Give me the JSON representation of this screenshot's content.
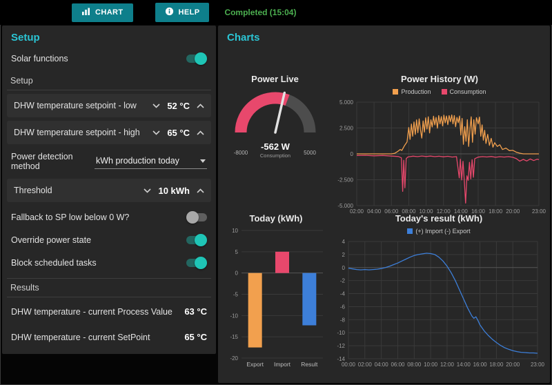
{
  "topbar": {
    "chart_label": "CHART",
    "help_label": "HELP",
    "status": "Completed (15:04)"
  },
  "setup_panel": {
    "title": "Setup",
    "solar": {
      "label": "Solar functions",
      "state": "on"
    },
    "section_setup": "Setup",
    "sp_low": {
      "label": "DHW temperature setpoint - low",
      "value": "52 °C"
    },
    "sp_high": {
      "label": "DHW temperature setpoint - high",
      "value": "65 °C"
    },
    "detection": {
      "label": "Power detection method",
      "value": "kWh production today"
    },
    "threshold": {
      "label": "Threshold",
      "value": "10 kWh"
    },
    "fallback": {
      "label": "Fallback to SP low below 0 W?",
      "state": "off"
    },
    "override": {
      "label": "Override power state",
      "state": "on"
    },
    "block": {
      "label": "Block scheduled tasks",
      "state": "on"
    },
    "section_results": "Results",
    "pv": {
      "label": "DHW temperature - current Process Value",
      "value": "63 °C"
    },
    "sp": {
      "label": "DHW temperature - current SetPoint",
      "value": "65 °C"
    }
  },
  "charts_panel": {
    "title": "Charts"
  },
  "colors": {
    "accent_teal": "#0e7f8b",
    "title_teal": "#2bc5d4",
    "status_green": "#4caf50",
    "production_orange": "#f2a04e",
    "consumption_red": "#e8486c",
    "result_blue": "#3d7fd9",
    "gauge_gray": "#4d4d4d",
    "toggle_on": "#1fc5b6"
  },
  "chart_data": [
    {
      "type": "gauge",
      "title": "Power Live",
      "value": -562,
      "value_label": "-562 W",
      "unit_label": "Consumption",
      "min": -8000,
      "max": 5000,
      "min_label": "-8000",
      "max_label": "5000",
      "zones": [
        {
          "from": -8000,
          "to": 0,
          "color": "#e8486c"
        },
        {
          "from": 0,
          "to": 5000,
          "color": "#4d4d4d"
        }
      ]
    },
    {
      "type": "line",
      "title": "Power History (W)",
      "xlim": [
        2,
        23
      ],
      "ylim": [
        -5000,
        5000
      ],
      "y_ticks": [
        {
          "v": 5000,
          "label": "5.000"
        },
        {
          "v": 2500,
          "label": "2.500"
        },
        {
          "v": 0,
          "label": "0"
        },
        {
          "v": -2500,
          "label": "-2.500"
        },
        {
          "v": -5000,
          "label": "-5.000"
        }
      ],
      "x_ticks": [
        {
          "v": 2,
          "label": "02:00"
        },
        {
          "v": 4,
          "label": "04:00"
        },
        {
          "v": 6,
          "label": "06:00"
        },
        {
          "v": 8,
          "label": "08:00"
        },
        {
          "v": 10,
          "label": "10:00"
        },
        {
          "v": 12,
          "label": "12:00"
        },
        {
          "v": 14,
          "label": "14:00"
        },
        {
          "v": 16,
          "label": "16:00"
        },
        {
          "v": 18,
          "label": "18:00"
        },
        {
          "v": 20,
          "label": "20:00"
        },
        {
          "v": 23,
          "label": "23:00"
        }
      ],
      "series": [
        {
          "name": "Production",
          "color": "#f2a04e",
          "points": [
            [
              2,
              0
            ],
            [
              3,
              0
            ],
            [
              4,
              0
            ],
            [
              5,
              0
            ],
            [
              6,
              0
            ],
            [
              6.4,
              60
            ],
            [
              6.7,
              220
            ],
            [
              7,
              420
            ],
            [
              7.2,
              330
            ],
            [
              7.5,
              780
            ],
            [
              7.8,
              1150
            ],
            [
              8,
              2550
            ],
            [
              8.15,
              1400
            ],
            [
              8.3,
              2880
            ],
            [
              8.45,
              1700
            ],
            [
              8.6,
              3080
            ],
            [
              8.75,
              1880
            ],
            [
              8.9,
              3280
            ],
            [
              9.05,
              2050
            ],
            [
              9.2,
              3380
            ],
            [
              9.35,
              2300
            ],
            [
              9.5,
              1520
            ],
            [
              9.65,
              3180
            ],
            [
              9.8,
              2100
            ],
            [
              9.95,
              3480
            ],
            [
              10.1,
              2400
            ],
            [
              10.25,
              3580
            ],
            [
              10.4,
              2020
            ],
            [
              10.55,
              3300
            ],
            [
              10.7,
              2600
            ],
            [
              10.85,
              3640
            ],
            [
              11,
              2800
            ],
            [
              11.15,
              3520
            ],
            [
              11.3,
              2480
            ],
            [
              11.45,
              3700
            ],
            [
              11.6,
              2900
            ],
            [
              11.75,
              3600
            ],
            [
              11.9,
              2700
            ],
            [
              12.05,
              3740
            ],
            [
              12.2,
              3000
            ],
            [
              12.35,
              3660
            ],
            [
              12.5,
              2820
            ],
            [
              12.65,
              3700
            ],
            [
              12.8,
              3120
            ],
            [
              12.95,
              3760
            ],
            [
              13.1,
              2900
            ],
            [
              13.25,
              3700
            ],
            [
              13.4,
              2620
            ],
            [
              13.55,
              3520
            ],
            [
              13.7,
              3010
            ],
            [
              13.85,
              3660
            ],
            [
              14,
              1820
            ],
            [
              14.15,
              3420
            ],
            [
              14.3,
              920
            ],
            [
              14.45,
              2620
            ],
            [
              14.6,
              1220
            ],
            [
              14.75,
              3300
            ],
            [
              14.9,
              720
            ],
            [
              15.05,
              2400
            ],
            [
              15.2,
              3580
            ],
            [
              15.35,
              1120
            ],
            [
              15.5,
              3300
            ],
            [
              15.65,
              1900
            ],
            [
              15.8,
              3500
            ],
            [
              16,
              2900
            ],
            [
              16.15,
              3560
            ],
            [
              16.3,
              1700
            ],
            [
              16.45,
              2800
            ],
            [
              16.6,
              1320
            ],
            [
              16.75,
              2280
            ],
            [
              16.9,
              1010
            ],
            [
              17.1,
              1880
            ],
            [
              17.3,
              820
            ],
            [
              17.5,
              1500
            ],
            [
              17.7,
              640
            ],
            [
              17.9,
              1080
            ],
            [
              18.2,
              720
            ],
            [
              18.5,
              880
            ],
            [
              18.8,
              420
            ],
            [
              19.2,
              560
            ],
            [
              19.6,
              310
            ],
            [
              20,
              340
            ],
            [
              20.4,
              160
            ],
            [
              20.8,
              70
            ],
            [
              21.2,
              0
            ],
            [
              22,
              0
            ],
            [
              23,
              0
            ]
          ]
        },
        {
          "name": "Consumption",
          "color": "#e8486c",
          "points": [
            [
              2,
              -160
            ],
            [
              3,
              -140
            ],
            [
              4,
              -185
            ],
            [
              5,
              -150
            ],
            [
              6,
              -210
            ],
            [
              6.8,
              -250
            ],
            [
              7.15,
              -380
            ],
            [
              7.3,
              -3620
            ],
            [
              7.42,
              -620
            ],
            [
              7.55,
              -3280
            ],
            [
              7.7,
              -460
            ],
            [
              7.9,
              -300
            ],
            [
              8.5,
              -220
            ],
            [
              9,
              -265
            ],
            [
              9.5,
              -205
            ],
            [
              10,
              -255
            ],
            [
              10.5,
              -215
            ],
            [
              11,
              -265
            ],
            [
              11.5,
              -225
            ],
            [
              12,
              -285
            ],
            [
              12.5,
              -235
            ],
            [
              13,
              -305
            ],
            [
              13.5,
              -265
            ],
            [
              13.82,
              -2320
            ],
            [
              13.95,
              -520
            ],
            [
              14.1,
              -2520
            ],
            [
              14.25,
              -720
            ],
            [
              14.4,
              -2620
            ],
            [
              14.55,
              -4760
            ],
            [
              14.7,
              -2120
            ],
            [
              14.85,
              -2560
            ],
            [
              15,
              -820
            ],
            [
              15.15,
              -2420
            ],
            [
              15.3,
              -560
            ],
            [
              15.45,
              -2260
            ],
            [
              15.6,
              -470
            ],
            [
              16,
              -310
            ],
            [
              16.5,
              -265
            ],
            [
              17,
              -300
            ],
            [
              17.5,
              -255
            ],
            [
              18,
              -325
            ],
            [
              18.5,
              -275
            ],
            [
              19,
              -305
            ],
            [
              19.5,
              -265
            ],
            [
              20,
              -330
            ],
            [
              20.4,
              -460
            ],
            [
              20.8,
              -710
            ],
            [
              21.2,
              -530
            ],
            [
              21.6,
              -690
            ],
            [
              22,
              -490
            ],
            [
              22.4,
              -650
            ],
            [
              22.8,
              -510
            ],
            [
              23,
              -560
            ]
          ]
        }
      ]
    },
    {
      "type": "bar",
      "title": "Today (kWh)",
      "categories": [
        "Export",
        "Import",
        "Result"
      ],
      "values": [
        -17.5,
        5.0,
        -12.3
      ],
      "colors": [
        "#f2a04e",
        "#e8486c",
        "#3d7fd9"
      ],
      "ylim": [
        -20,
        10
      ],
      "y_ticks": [
        {
          "v": 10,
          "label": "10"
        },
        {
          "v": 5,
          "label": "5"
        },
        {
          "v": 0,
          "label": "0"
        },
        {
          "v": -5,
          "label": "-5"
        },
        {
          "v": -10,
          "label": "-10"
        },
        {
          "v": -15,
          "label": "-15"
        },
        {
          "v": -20,
          "label": "-20"
        }
      ]
    },
    {
      "type": "line",
      "title": "Today's result (kWh)",
      "xlim": [
        0,
        23
      ],
      "ylim": [
        -14,
        4
      ],
      "y_ticks": [
        {
          "v": 4,
          "label": "4"
        },
        {
          "v": 2,
          "label": "2"
        },
        {
          "v": 0,
          "label": "0"
        },
        {
          "v": -2,
          "label": "-2"
        },
        {
          "v": -4,
          "label": "-4"
        },
        {
          "v": -6,
          "label": "-6"
        },
        {
          "v": -8,
          "label": "-8"
        },
        {
          "v": -10,
          "label": "-10"
        },
        {
          "v": -12,
          "label": "-12"
        },
        {
          "v": -14,
          "label": "-14"
        }
      ],
      "x_ticks": [
        {
          "v": 0,
          "label": "00:00"
        },
        {
          "v": 2,
          "label": "02:00"
        },
        {
          "v": 4,
          "label": "04:00"
        },
        {
          "v": 6,
          "label": "06:00"
        },
        {
          "v": 8,
          "label": "08:00"
        },
        {
          "v": 10,
          "label": "10:00"
        },
        {
          "v": 12,
          "label": "12:00"
        },
        {
          "v": 14,
          "label": "14:00"
        },
        {
          "v": 16,
          "label": "16:00"
        },
        {
          "v": 18,
          "label": "18:00"
        },
        {
          "v": 20,
          "label": "20:00"
        },
        {
          "v": 23,
          "label": "23:00"
        }
      ],
      "series": [
        {
          "name": "(+) Import (-) Export",
          "color": "#3d7fd9",
          "points": [
            [
              0,
              -0.1
            ],
            [
              0.5,
              -0.2
            ],
            [
              1,
              -0.3
            ],
            [
              1.5,
              -0.35
            ],
            [
              2,
              -0.3
            ],
            [
              2.5,
              -0.35
            ],
            [
              3,
              -0.3
            ],
            [
              3.5,
              -0.25
            ],
            [
              4,
              -0.15
            ],
            [
              4.5,
              0.0
            ],
            [
              5,
              0.2
            ],
            [
              5.5,
              0.45
            ],
            [
              6,
              0.7
            ],
            [
              6.5,
              1.0
            ],
            [
              7,
              1.3
            ],
            [
              7.5,
              1.6
            ],
            [
              8,
              1.85
            ],
            [
              8.5,
              2.0
            ],
            [
              9,
              2.1
            ],
            [
              9.5,
              2.2
            ],
            [
              10,
              2.15
            ],
            [
              10.5,
              2.0
            ],
            [
              11,
              1.6
            ],
            [
              11.5,
              1.0
            ],
            [
              12,
              0.2
            ],
            [
              12.5,
              -0.8
            ],
            [
              13,
              -2.0
            ],
            [
              13.5,
              -3.4
            ],
            [
              14,
              -4.8
            ],
            [
              14.5,
              -6.2
            ],
            [
              15,
              -7.4
            ],
            [
              15.25,
              -7.8
            ],
            [
              15.5,
              -7.55
            ],
            [
              15.75,
              -8.1
            ],
            [
              16,
              -8.8
            ],
            [
              16.5,
              -9.7
            ],
            [
              17,
              -10.4
            ],
            [
              17.5,
              -11.0
            ],
            [
              18,
              -11.5
            ],
            [
              18.5,
              -11.95
            ],
            [
              19,
              -12.3
            ],
            [
              19.5,
              -12.55
            ],
            [
              20,
              -12.75
            ],
            [
              20.5,
              -12.9
            ],
            [
              21,
              -13.0
            ],
            [
              21.5,
              -13.05
            ],
            [
              22,
              -13.1
            ],
            [
              22.5,
              -13.1
            ],
            [
              23,
              -13.15
            ]
          ]
        }
      ]
    }
  ]
}
